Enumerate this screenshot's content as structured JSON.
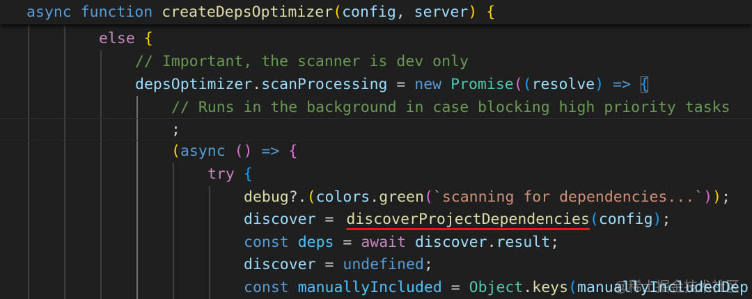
{
  "lines": {
    "l0": [
      "async",
      " ",
      "function",
      " ",
      "createDepsOptimizer",
      "(",
      "config",
      ", ",
      "server",
      ") ",
      "{"
    ],
    "l1": [
      "else",
      " ",
      "{"
    ],
    "l2": [
      "// Important, the scanner is dev only"
    ],
    "l3": [
      "depsOptimizer",
      ".",
      "scanProcessing",
      " = ",
      "new",
      " ",
      "Promise",
      "(",
      "(",
      "resolve",
      ")",
      " => ",
      "{"
    ],
    "l4": [
      "// Runs in the background in case blocking high priority tasks"
    ],
    "l5": [
      ";"
    ],
    "l6": [
      "(",
      "async",
      " ",
      "()",
      " => ",
      "{"
    ],
    "l7": [
      "try",
      " ",
      "{"
    ],
    "l8": [
      "debug",
      "?.",
      "(",
      "colors",
      ".",
      "green",
      "(",
      "`scanning for dependencies...`",
      ")",
      ")",
      ";"
    ],
    "l9": [
      "discover",
      " = ",
      "discoverProjectDependencies",
      "(",
      "config",
      ")",
      ";"
    ],
    "l10": [
      "const",
      " ",
      "deps",
      " = ",
      "await",
      " ",
      "discover",
      ".",
      "result",
      ";"
    ],
    "l11": [
      "discover",
      " = ",
      "undefined",
      ";"
    ],
    "l12": [
      "const",
      " ",
      "manuallyIncluded",
      " = ",
      "Object",
      ".",
      "keys",
      "(",
      "manuallyIncludedDep"
    ]
  },
  "watermark": "@稀土掘金技术社区",
  "icons": {
    "inlay_hint": "code-lens-dot-icon",
    "cursor": "text-cursor-icon"
  },
  "colors": {
    "background": "#1f1f1f",
    "keyword": "#569cd6",
    "control": "#c586c0",
    "function": "#dcdcaa",
    "variable": "#9cdcfe",
    "comment": "#6a9955",
    "string": "#ce9178",
    "class": "#4ec9b0",
    "underline": "#e5181b"
  }
}
